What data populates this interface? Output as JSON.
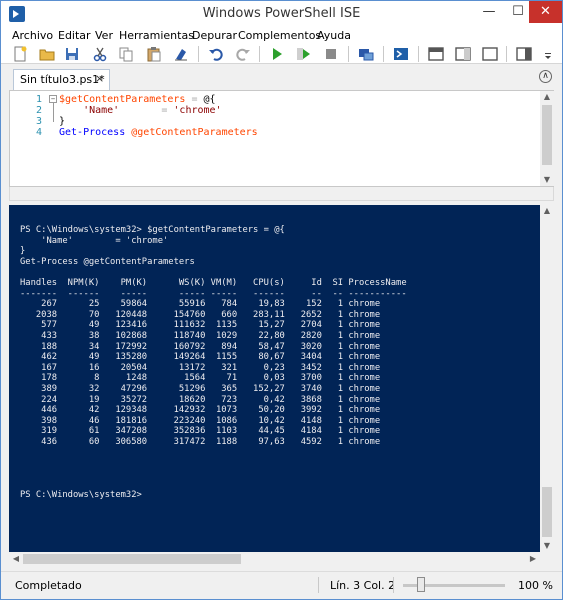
{
  "window": {
    "title": "Windows PowerShell ISE",
    "minimize": "—",
    "maximize": "☐",
    "close": "✕"
  },
  "menu": [
    {
      "label": "Archivo"
    },
    {
      "label": "Editar"
    },
    {
      "label": "Ver"
    },
    {
      "label": "Herramientas"
    },
    {
      "label": "Depurar"
    },
    {
      "label": "Complementos"
    },
    {
      "label": "Ayuda"
    }
  ],
  "toolbar_icons": [
    "new-icon",
    "open-icon",
    "save-icon",
    "cut-icon",
    "copy-icon",
    "paste-icon",
    "clear-icon",
    "undo-icon",
    "redo-icon",
    "run-icon",
    "run-selection-icon",
    "stop-icon",
    "new-remote-icon",
    "powershell-icon",
    "layout-top-icon",
    "layout-right-icon",
    "layout-max-icon",
    "show-commands-icon"
  ],
  "tab": {
    "label": "Sin título3.ps1*",
    "close": "×",
    "collapse": "∧"
  },
  "editor": {
    "lines": [
      {
        "num": "1",
        "parts": [
          {
            "t": "$getContentParameters",
            "c": "var"
          },
          {
            "t": " = ",
            "c": "op"
          },
          {
            "t": "@{",
            "c": "plain"
          }
        ]
      },
      {
        "num": "2",
        "parts": [
          {
            "t": "    'Name'",
            "c": "str"
          },
          {
            "t": "       = ",
            "c": "op"
          },
          {
            "t": "'chrome'",
            "c": "str"
          }
        ]
      },
      {
        "num": "3",
        "parts": [
          {
            "t": "}",
            "c": "plain"
          }
        ]
      },
      {
        "num": "4",
        "parts": [
          {
            "t": "Get-Process",
            "c": "cmd"
          },
          {
            "t": " ",
            "c": "plain"
          },
          {
            "t": "@getContentParameters",
            "c": "var"
          }
        ]
      }
    ]
  },
  "console": {
    "lines": [
      "PS C:\\Windows\\system32> $getContentParameters = @{",
      "    'Name'        = 'chrome'",
      "}",
      "Get-Process @getContentParameters",
      "",
      "Handles  NPM(K)    PM(K)      WS(K) VM(M)   CPU(s)     Id  SI ProcessName",
      "-------  ------    -----      ----- -----   ------     --  -- -----------",
      "    267      25    59864      55916   784    19,83    152   1 chrome",
      "   2038      70   120448     154760   660   283,11   2652   1 chrome",
      "    577      49   123416     111632  1135    15,27   2704   1 chrome",
      "    433      38   102868     118740  1029    22,80   2820   1 chrome",
      "    188      34   172992     160792   894    58,47   3020   1 chrome",
      "    462      49   135280     149264  1155    80,67   3404   1 chrome",
      "    167      16    20504      13172   321     0,23   3452   1 chrome",
      "    178       8     1248       1564    71     0,03   3700   1 chrome",
      "    389      32    47296      51296   365   152,27   3740   1 chrome",
      "    224      19    35272      18620   723     0,42   3868   1 chrome",
      "    446      42   129348     142932  1073    50,20   3992   1 chrome",
      "    398      46   181816     223240  1086    10,42   4148   1 chrome",
      "    319      61   347208     352836  1103    44,45   4184   1 chrome",
      "    436      60   306580     317472  1188    97,63   4592   1 chrome",
      "",
      "",
      "",
      "",
      "PS C:\\Windows\\system32>"
    ]
  },
  "statusbar": {
    "status": "Completado",
    "position": "Lín. 3  Col. 2",
    "zoom": "100 %",
    "zoom_fraction": 0.18
  }
}
